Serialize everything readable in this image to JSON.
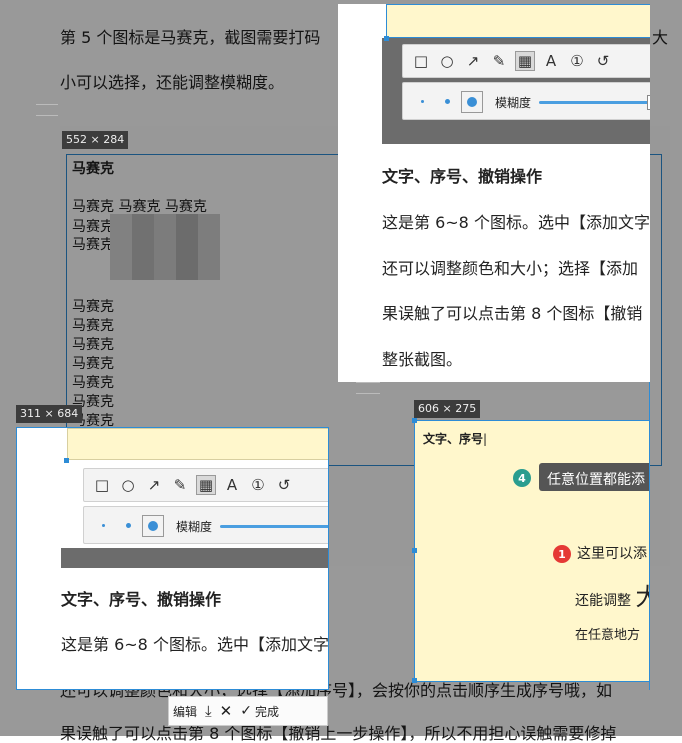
{
  "document": {
    "line1": "第 5 个图标是马赛克，截图需要打码",
    "line1_tail": "大",
    "line2": "小可以选择，还能调整模糊度。",
    "bottom_line1": "还可以调整颜色和大小；选择【添加序号】，会按你的点击顺序生成序号哦，如",
    "bottom_line2": "果误触了可以点击第 8 个图标【撤销上一步操作】，所以不用担心误触需要修掉"
  },
  "size_labels": {
    "main": "552 × 284",
    "left": "311 × 684",
    "right": "606 × 275"
  },
  "mosaic_capture": {
    "title": "马赛克",
    "row": "马赛克  马赛克  马赛克",
    "items": [
      "马赛克",
      "马赛克",
      "马赛克",
      "马赛克",
      "马赛克",
      "马赛克",
      "马赛克",
      "马赛克",
      "马赛克",
      "马赛克"
    ]
  },
  "blur_label": "模糊度",
  "section": {
    "heading": "文字、序号、撤销操作",
    "para1": "这是第 6~8 个图标。选中【添加文字",
    "para2": "还可以调整颜色和大小；选择【添加",
    "para3": "果误触了可以点击第 8 个图标【撤销",
    "para4": "整张截图。"
  },
  "left_section": {
    "heading": "文字、序号、撤销操作",
    "para1": "这是第 6~8 个图标。选中【添加文字"
  },
  "demo_capture": {
    "title": "文字、序号",
    "badge4": "4",
    "tip4": "任意位置都能添",
    "badge1": "1",
    "line1": "这里可以添",
    "line2": "还能调整",
    "line2_big": "大",
    "line3": "在任意地方"
  },
  "action_bar": {
    "edit": "编辑",
    "done": "完成"
  },
  "colors": {
    "accent": "#2d8cd6",
    "badge_teal": "#2a9d8f",
    "badge_red": "#e53935"
  }
}
